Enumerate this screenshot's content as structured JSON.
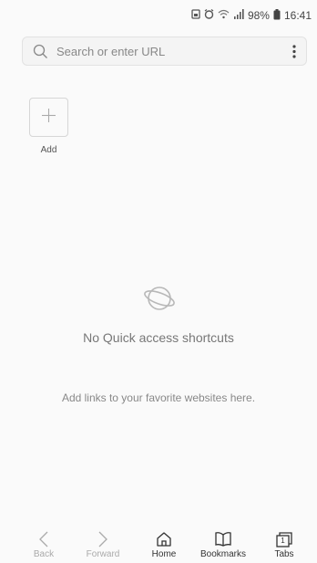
{
  "status_bar": {
    "battery": "98%",
    "time": "16:41",
    "icons": [
      "sim-icon",
      "alarm-icon",
      "wifi-icon",
      "signal-icon",
      "battery-icon"
    ]
  },
  "search": {
    "placeholder": "Search or enter URL",
    "icon": "search-icon",
    "menu_icon": "more-vertical-icon"
  },
  "quick_access": {
    "add_label": "Add",
    "add_icon": "plus-icon"
  },
  "empty_state": {
    "icon": "planet-icon",
    "title": "No Quick access shortcuts",
    "subtitle": "Add links to your favorite websites here."
  },
  "bottom_nav": {
    "back": "Back",
    "forward": "Forward",
    "home": "Home",
    "bookmarks": "Bookmarks",
    "tabs": "Tabs",
    "tab_count": "1"
  }
}
